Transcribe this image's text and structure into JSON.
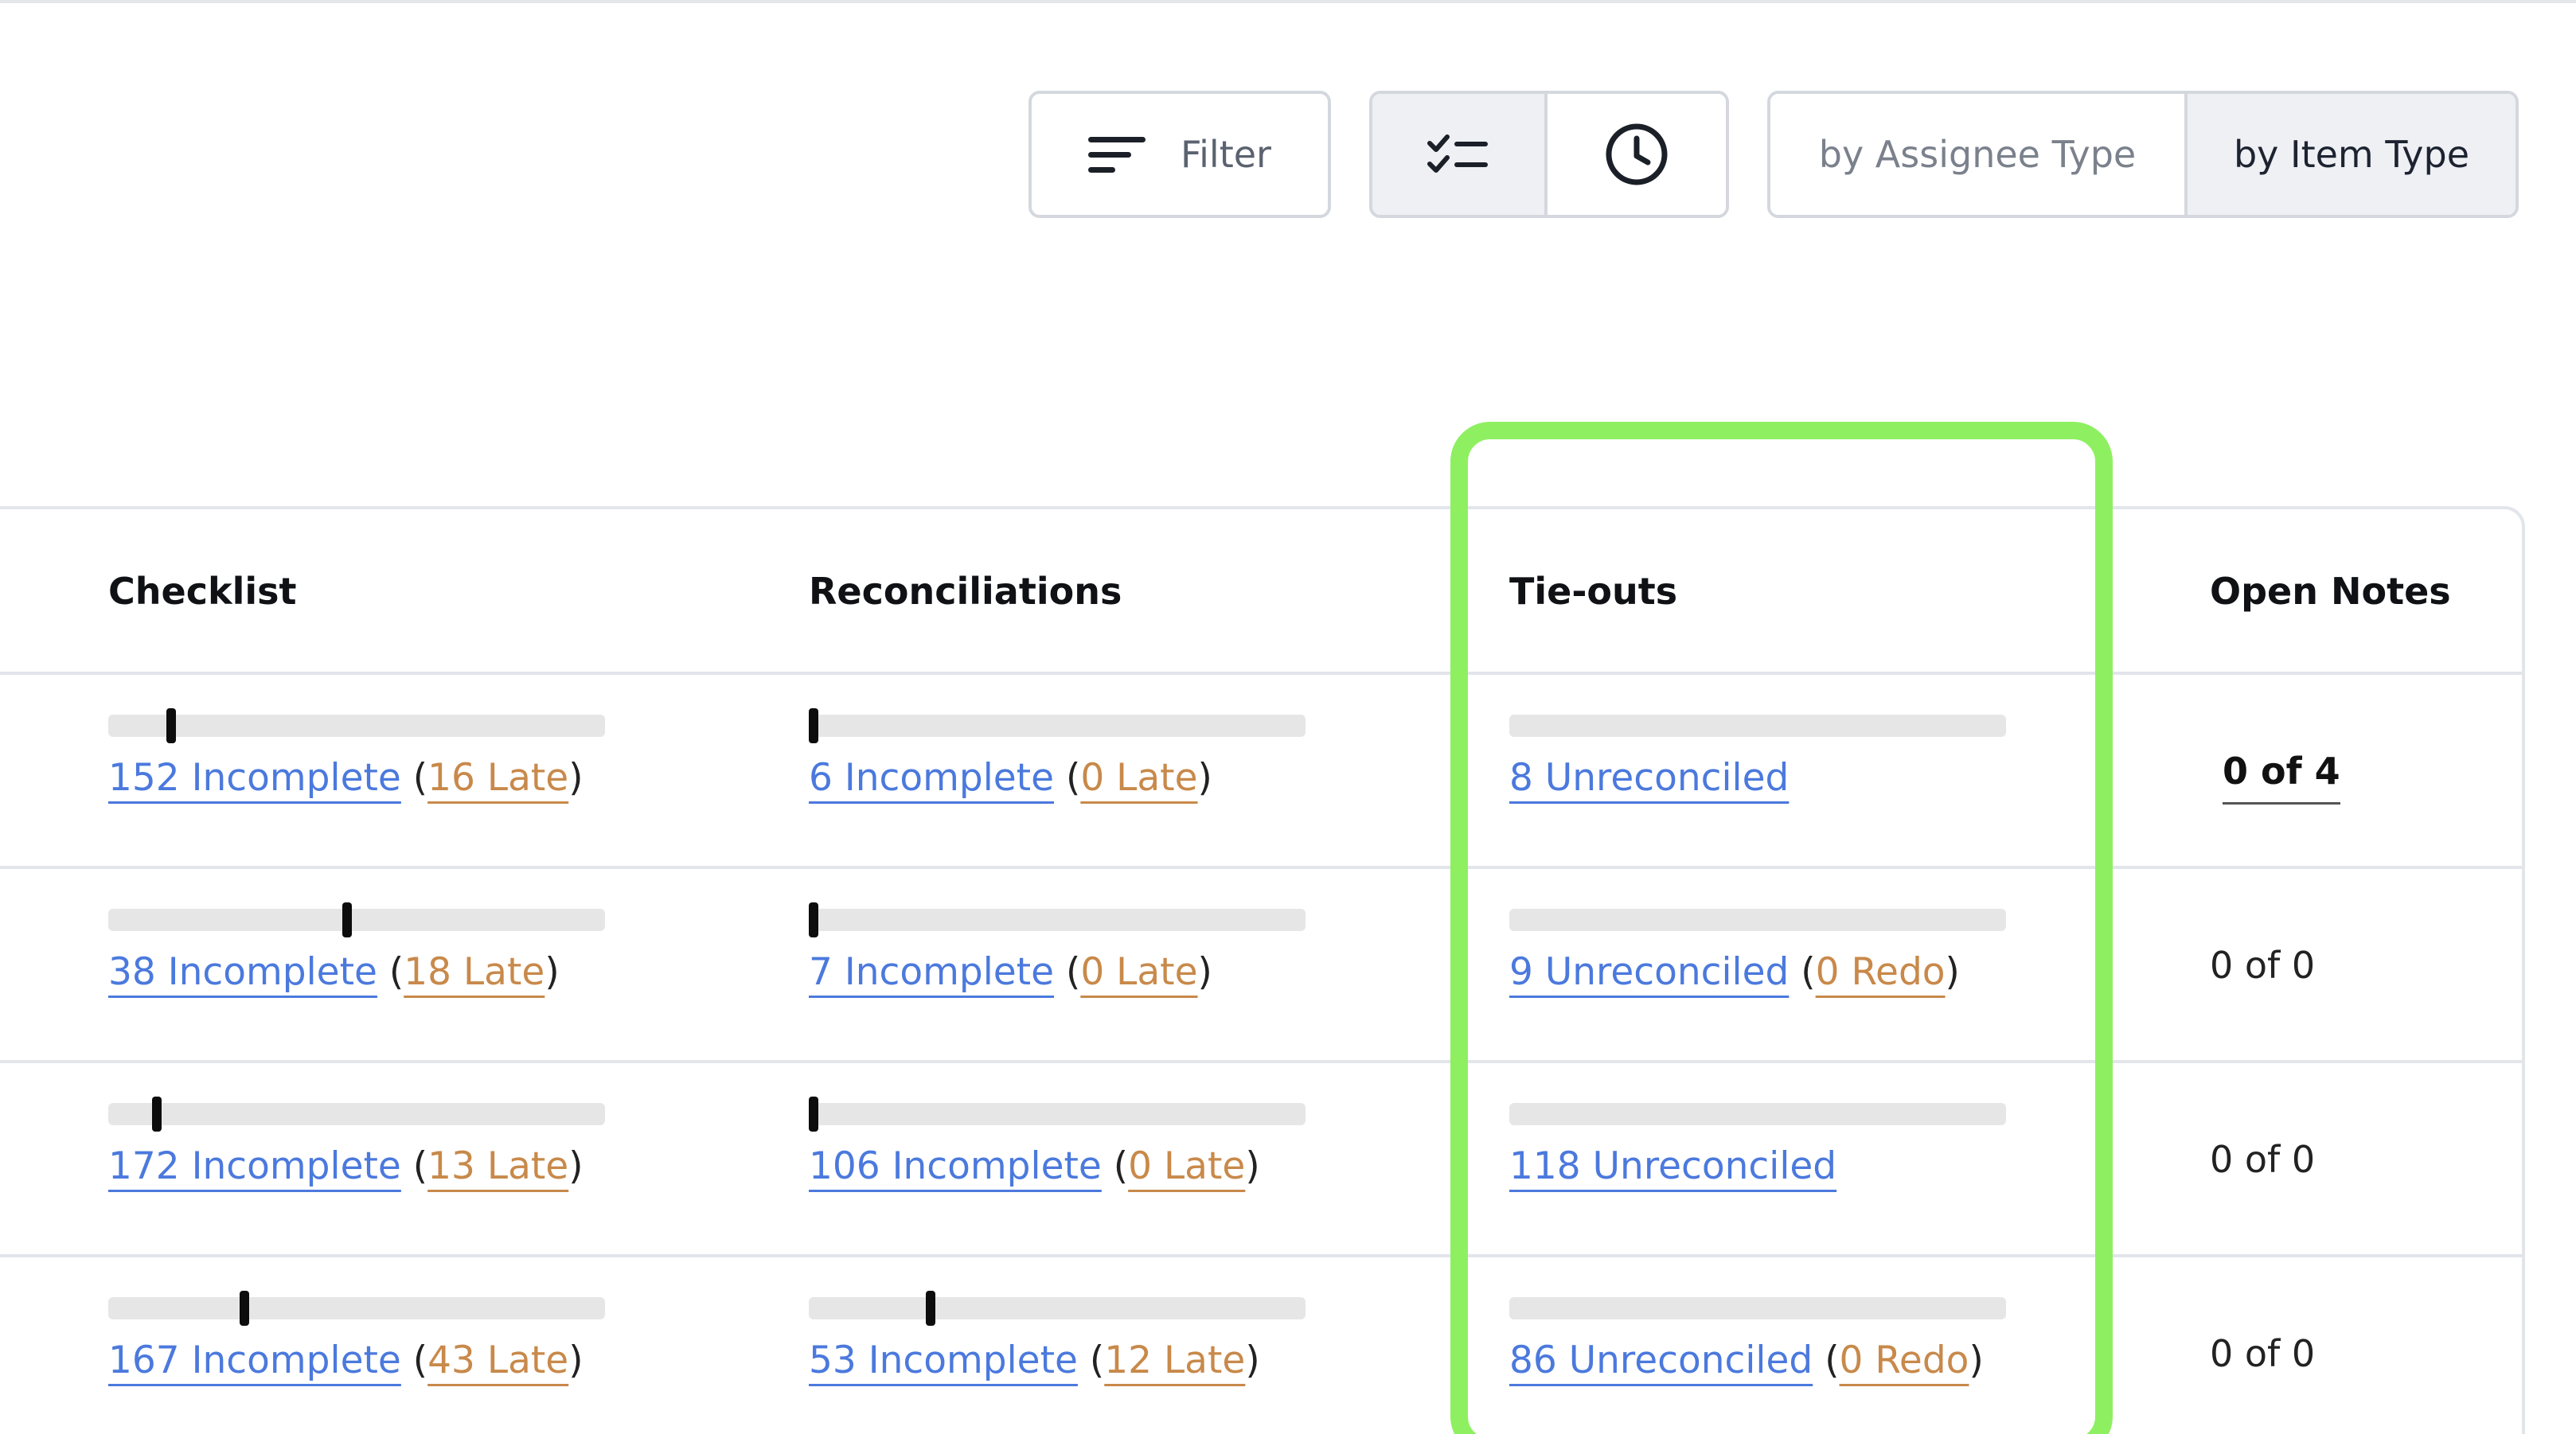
{
  "toolbar": {
    "filter_label": "Filter",
    "group_by": {
      "assignee": "by Assignee Type",
      "item": "by Item Type",
      "selected": "by Item Type"
    }
  },
  "table": {
    "headers": [
      "Checklist",
      "Reconciliations",
      "Tie-outs",
      "Open Notes"
    ],
    "rows": [
      {
        "checklist": {
          "progress": 0.12,
          "incomplete": "152 Incomplete",
          "late": "16 Late"
        },
        "reconciliations": {
          "progress": 0.0,
          "incomplete": "6 Incomplete",
          "late": "0 Late"
        },
        "tieouts": {
          "unreconciled": "8 Unreconciled"
        },
        "notes": "0 of 4"
      },
      {
        "checklist": {
          "progress": 0.48,
          "incomplete": "38 Incomplete",
          "late": "18 Late"
        },
        "reconciliations": {
          "progress": 0.0,
          "incomplete": "7 Incomplete",
          "late": "0 Late"
        },
        "tieouts": {
          "unreconciled": "9 Unreconciled",
          "redo": "0 Redo"
        },
        "notes": "0 of 0"
      },
      {
        "checklist": {
          "progress": 0.09,
          "incomplete": "172 Incomplete",
          "late": "13 Late"
        },
        "reconciliations": {
          "progress": 0.0,
          "incomplete": "106 Incomplete",
          "late": "0 Late"
        },
        "tieouts": {
          "unreconciled": "118 Unreconciled"
        },
        "notes": "0 of 0"
      },
      {
        "checklist": {
          "progress": 0.27,
          "incomplete": "167 Incomplete",
          "late": "43 Late"
        },
        "reconciliations": {
          "progress": 0.24,
          "incomplete": "53 Incomplete",
          "late": "12 Late"
        },
        "tieouts": {
          "unreconciled": "86 Unreconciled",
          "redo": "0 Redo"
        },
        "notes": "0 of 0"
      }
    ]
  },
  "icons": {
    "filter": "filter-lines-icon",
    "checklist_view": "checklist-icon",
    "clock_view": "clock-icon"
  },
  "colors": {
    "link": "#4b79dd",
    "late": "#c8894a",
    "highlight": "#8ef061",
    "bar_track": "#e6e6e6",
    "bar_marker": "#0d0d0d"
  }
}
